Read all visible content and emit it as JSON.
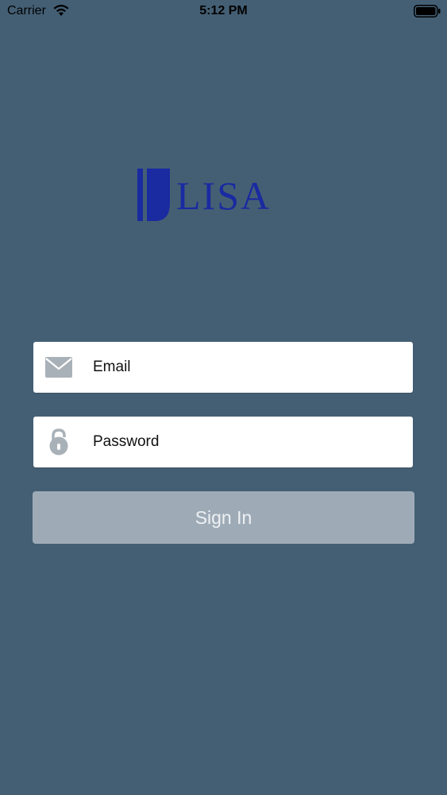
{
  "status_bar": {
    "carrier": "Carrier",
    "time": "5:12 PM"
  },
  "logo": {
    "text": "LISA",
    "color": "#1a2aa0"
  },
  "form": {
    "email_placeholder": "Email",
    "password_placeholder": "Password",
    "sign_in_label": "Sign In"
  },
  "colors": {
    "background": "#445f74",
    "field_background": "#ffffff",
    "button_background": "#9eabb7",
    "icon_gray": "#a9b1b8"
  }
}
